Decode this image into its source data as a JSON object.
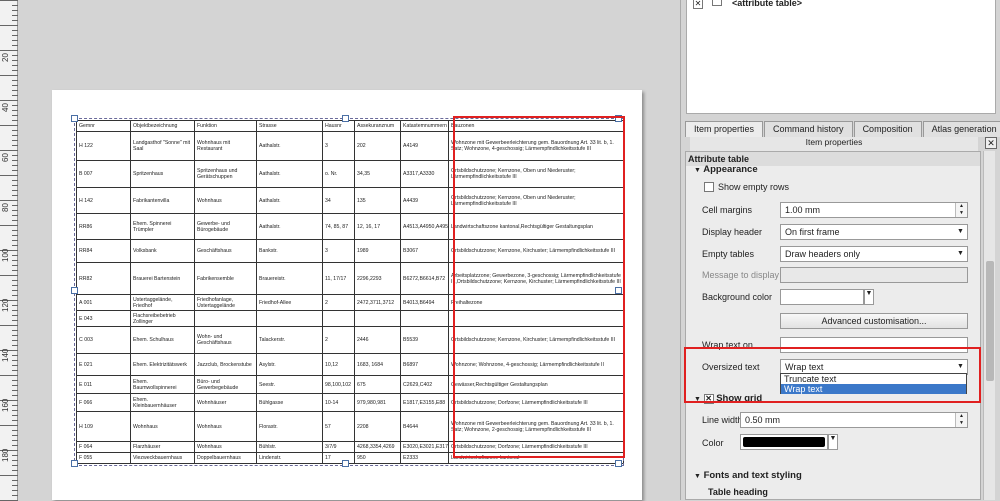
{
  "ruler": {
    "labels": [
      "20",
      "40",
      "60",
      "80",
      "100",
      "120",
      "140",
      "160",
      "180"
    ]
  },
  "layers": {
    "item_label": "<attribute table>"
  },
  "tabs": [
    "Item properties",
    "Command history",
    "Composition",
    "Atlas generation"
  ],
  "panel_title": "Item properties",
  "section_title": "Attribute table",
  "appearance": {
    "group_label": "Appearance",
    "show_empty_rows": "Show empty rows",
    "cell_margins_label": "Cell margins",
    "cell_margins_value": "1.00 mm",
    "display_header_label": "Display header",
    "display_header_value": "On first frame",
    "empty_tables_label": "Empty tables",
    "empty_tables_value": "Draw headers only",
    "message_label": "Message to display",
    "background_label": "Background color",
    "advanced_button": "Advanced customisation...",
    "wrap_on_label": "Wrap text on",
    "oversized_label": "Oversized text",
    "oversized_value": "Wrap text",
    "oversized_options": [
      "Truncate text",
      "Wrap text"
    ]
  },
  "grid": {
    "group_label": "Show grid",
    "line_width_label": "Line width",
    "line_width_value": "0.50 mm",
    "color_label": "Color"
  },
  "fonts": {
    "group_label": "Fonts and text styling",
    "table_heading": "Table heading"
  },
  "colors": {
    "red_frame": "#e02020",
    "highlight": "#3b78c9"
  },
  "table": {
    "headers": [
      "Gemnr",
      "Objektbezeichnung",
      "Funktion",
      "Strasse",
      "Hausnr",
      "Assekuranznum",
      "Katastemnummern",
      "Bauzonen"
    ],
    "rows": [
      [
        "H 122",
        "Landgasthof \"Sonne\" mit Saal",
        "Wohnhaus mit Restaurant",
        "Aathalstr.",
        "3",
        "202",
        "A4149",
        "Wohnzone mit Gewerbeerleichterung gem. Bauordnung Art. 33 lit. b, 1. Satz; Wohnzone, 4-geschossig; Lärmempfindlichkeitsstufe III"
      ],
      [
        "B 007",
        "Spritzenhaus",
        "Spritzenhaus und Gerätschuppen",
        "Aathalstr.",
        "o. Nr.",
        "34,35",
        "A3317,A3330",
        "Ortsbildschutzzone; Kernzone, Oben und Niederuster; Lärmempfindlichkeitsstufe III"
      ],
      [
        "H 142",
        "Fabrikantenvilla",
        "Wohnhaus",
        "Aathalstr.",
        "34",
        "135",
        "A4439",
        "Ortsbildschutzzone; Kernzone, Oben und Niederuster; Lärmempfindlichkeitsstufe III"
      ],
      [
        "RR86",
        "Ehem. Spinnerei Trümpler",
        "Gewerbe- und Bürogebäude",
        "Aathalstr.",
        "74, 85, 87",
        "12, 16, 17",
        "A4513,A4950,A495",
        "Landwirtschaftszone kantonal,Rechtsgültiger Gestaltungsplan"
      ],
      [
        "RR84",
        "Volksbank",
        "Geschäftshaus",
        "Bankstr.",
        "3",
        "1989",
        "B3067",
        "Ortsbildschutzzone; Kernzone, Kirchuster; Lärmempfindlichkeitsstufe III"
      ],
      [
        "RR82",
        "Brauerei Bartenstein",
        "Fabrikensemble",
        "Brauereistr.",
        "11, 17/17",
        "2296,2293",
        "B6272,B6614,B72",
        "Arbeitsplatzzone; Gewerbezone, 3-geschossig; Lärmempfindlichkeitsstufe III,Ortsbildschutzzone; Kernzone, Kirchuster; Lärmempfindlichkeitsstufe III"
      ],
      [
        "A 001",
        "Ustertaggelände, Friedhof",
        "Friedhofanlage, Ustertaggelände",
        "Friedhof-Allee",
        "2",
        "2472,3711,3712",
        "B4013,B6494",
        "Freihaltezone"
      ],
      [
        "E 043",
        "Flachsreibebetrieb Zollinger",
        "",
        "",
        "",
        "",
        "",
        ""
      ],
      [
        "C 003",
        "Ehem. Schulhaus",
        "Wohn- und Geschäftshaus",
        "Talackerstr.",
        "2",
        "2446",
        "B5539",
        "Ortsbildschutzzone; Kernzone, Kirchuster; Lärmempfindlichkeitsstufe III"
      ],
      [
        "E 021",
        "Ehem. Elektrizitätswerk",
        "Jazzclub, Brockenstube",
        "Asylstr.",
        "10,12",
        "1683, 1684",
        "B6897",
        "Wohnzone; Wohnzone, 4-geschossig; Lärmempfindlichkeitsstufe II"
      ],
      [
        "E 011",
        "Ehem. Baumwollspinnerei",
        "Büro- und Gewerbegebäude",
        "Seestr.",
        "98,100,102",
        "675",
        "C2629,C402",
        "Gewässer,Rechtsgültiger Gestaltungsplan"
      ],
      [
        "F 066",
        "Ehem. Kleinbauernhäuser",
        "Wohnhäuser",
        "Bühlgasse",
        "10-14",
        "979,980,981",
        "E1817,E3155,E88",
        "Ortsbildschutzzone; Dorfzone; Lärmempfindlichkeitsstufe III"
      ],
      [
        "H 109",
        "Wohnhaus",
        "Wohnhaus",
        "Florastr.",
        "57",
        "2208",
        "B4644",
        "Wohnzone mit Gewerbeerleichterung gem. Bauordnung Art. 33 lit. b, 1. Satz; Wohnzone, 2-geschossig; Lärmempfindlichkeitsstufe III"
      ],
      [
        "F 064",
        "Flarzhäuser",
        "Wohnhaus",
        "Bühlstr.",
        "3/7/9",
        "4268,3354,4269",
        "E3020,E3021,E317",
        "Ortsbildschutzzone; Dorfzone; Lärmempfindlichkeitsstufe III"
      ],
      [
        "F 055",
        "Viezweckbauernhaus",
        "Doppelbauernhaus",
        "Lindenstr.",
        "17",
        "950",
        "E2333",
        "Landwirtschaftszone kantonal"
      ]
    ]
  }
}
